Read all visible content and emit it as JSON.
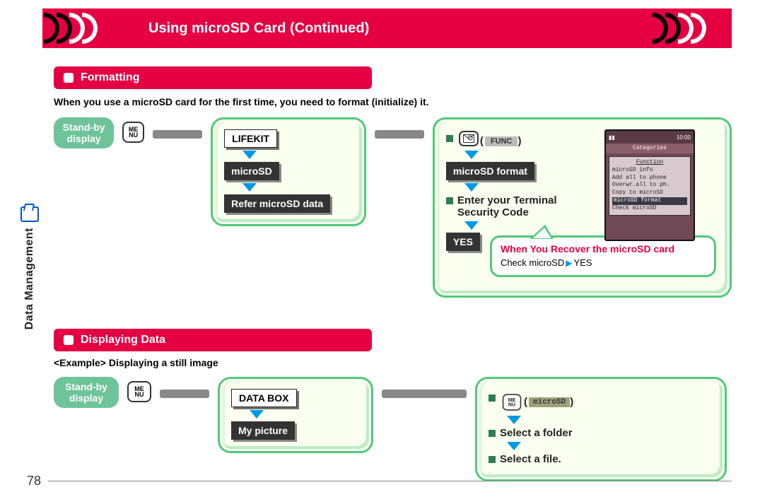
{
  "header": {
    "title": "Using microSD Card (Continued)"
  },
  "sidebar": {
    "label": "Data Management",
    "icon": "folder-open-icon"
  },
  "page_number": "78",
  "section1": {
    "pill": "Formatting",
    "intro": "When you use a microSD card for the first time, you need to format (initialize) it.",
    "standby": "Stand-by display",
    "menu_btn": "MENU",
    "panelA": {
      "step1": "LIFEKIT",
      "step2": "microSD",
      "step3": "Refer microSD data"
    },
    "panelB": {
      "func_label": "FUNC",
      "microsd_format": "microSD format",
      "enter_code": "Enter your Terminal Security Code",
      "yes": "YES",
      "callout_title": "When You Recover the microSD card",
      "callout_left": "Check microSD",
      "callout_right": "YES",
      "phone": {
        "top_time": "10:00",
        "title": "Categories",
        "func_header": "Function",
        "items": [
          "microSD info",
          "Add all to phone",
          "Overwr.all to ph.",
          "Copy to microSD",
          "microSD format",
          "Check microSD"
        ]
      }
    }
  },
  "section2": {
    "pill": "Displaying Data",
    "example": "<Example> Displaying a still image",
    "standby": "Stand-by display",
    "menu_btn": "MENU",
    "panelC": {
      "step1": "DATA BOX",
      "step2": "My picture"
    },
    "panelD": {
      "menu_btn": "MENU",
      "chip": "microSD",
      "line2": "Select a folder",
      "line3": "Select a file."
    }
  }
}
